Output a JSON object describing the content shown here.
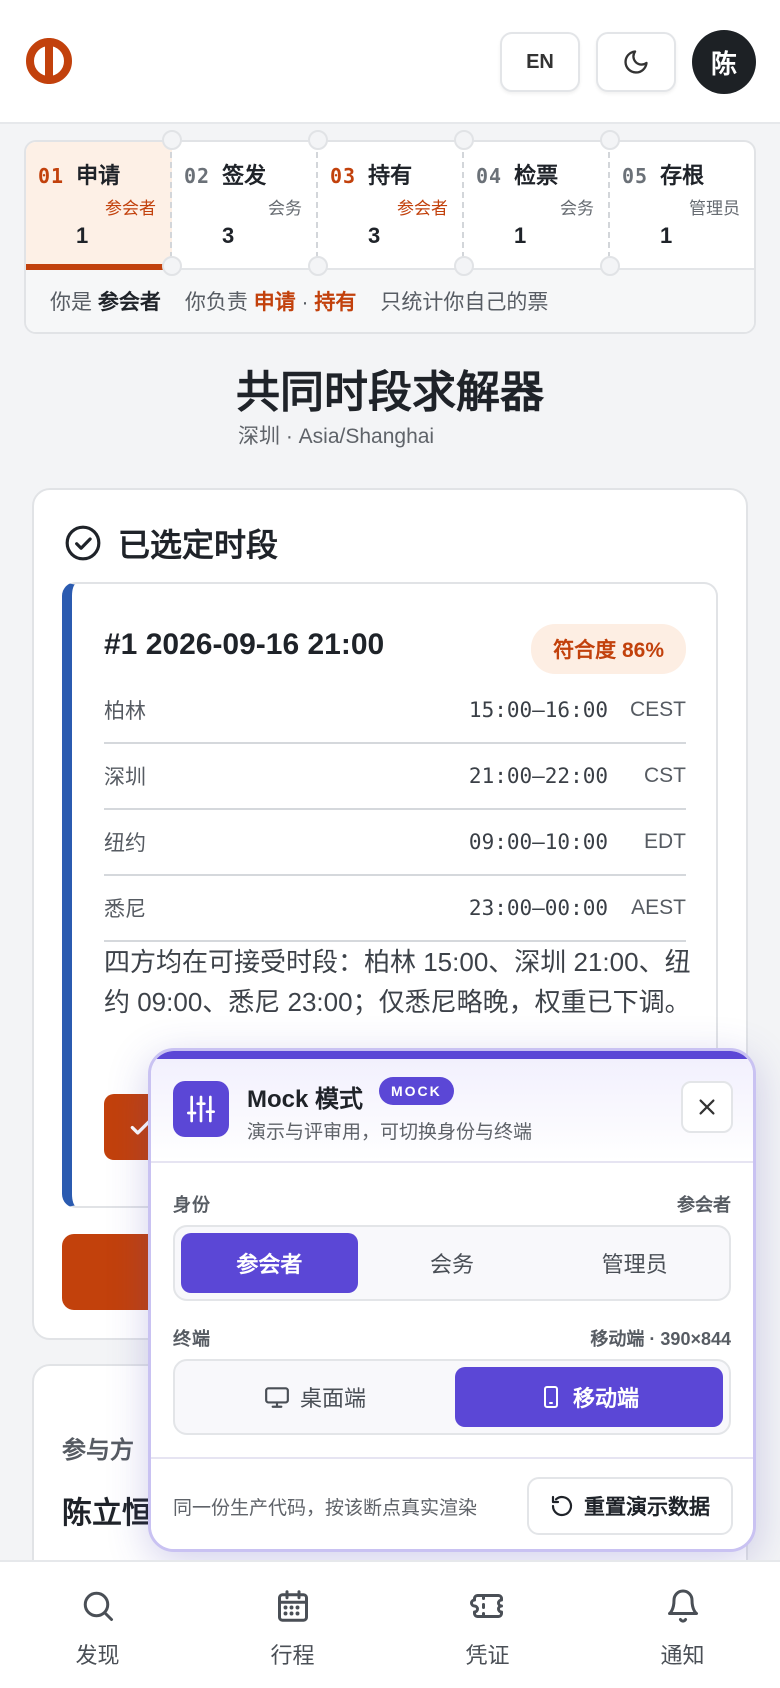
{
  "header": {
    "lang_label": "EN",
    "avatar_text": "陈",
    "brand_color": "#c2410c"
  },
  "stepper": {
    "steps": [
      {
        "num": "01",
        "name": "申请",
        "role": "参会者",
        "count": "1",
        "own": true,
        "active": true
      },
      {
        "num": "02",
        "name": "签发",
        "role": "会务",
        "count": "3",
        "own": false,
        "active": false
      },
      {
        "num": "03",
        "name": "持有",
        "role": "参会者",
        "count": "3",
        "own": true,
        "active": false
      },
      {
        "num": "04",
        "name": "检票",
        "role": "会务",
        "count": "1",
        "own": false,
        "active": false
      },
      {
        "num": "05",
        "name": "存根",
        "role": "管理员",
        "count": "1",
        "own": false,
        "active": false
      }
    ],
    "strip": {
      "you_are_prefix": "你是",
      "you_are_role": "参会者",
      "responsible_prefix": "你负责",
      "responsible_1": "申请",
      "responsible_sep": "·",
      "responsible_2": "持有",
      "note": "只统计你自己的票"
    }
  },
  "page": {
    "title": "共同时段求解器",
    "subtitle": "深圳 · Asia/Shanghai"
  },
  "selected": {
    "heading": "已选定时段",
    "slot_title": "#1 2026-09-16 21:00",
    "match_badge": "符合度 86%",
    "accent_color": "#2b5bb0",
    "rows": [
      {
        "city": "柏林",
        "time": "15:00–16:00",
        "abbr": "CEST"
      },
      {
        "city": "深圳",
        "time": "21:00–22:00",
        "abbr": "CST"
      },
      {
        "city": "纽约",
        "time": "09:00–10:00",
        "abbr": "EDT"
      },
      {
        "city": "悉尼",
        "time": "23:00–00:00",
        "abbr": "AEST"
      }
    ],
    "note": "四方均在可接受时段：柏林 15:00、深圳 21:00、纽约 09:00、悉尼 23:00；仅悉尼略晚，权重已下调。"
  },
  "participants": {
    "label": "参与方",
    "name": "陈立恒"
  },
  "mock": {
    "title": "Mock 模式",
    "tag": "MOCK",
    "desc": "演示与评审用，可切换身份与终端",
    "identity_label": "身份",
    "identity_value": "参会者",
    "identities": [
      "参会者",
      "会务",
      "管理员"
    ],
    "identity_selected": 0,
    "terminal_label": "终端",
    "terminal_value": "移动端 · 390×844",
    "terminals": [
      "桌面端",
      "移动端"
    ],
    "terminal_selected": 1,
    "footer_text": "同一份生产代码，按该断点真实渲染",
    "reset_label": "重置演示数据",
    "accent_color": "#5b47d6"
  },
  "nav": {
    "items": [
      {
        "label": "发现",
        "icon": "search-icon"
      },
      {
        "label": "行程",
        "icon": "calendar-icon"
      },
      {
        "label": "凭证",
        "icon": "ticket-icon"
      },
      {
        "label": "通知",
        "icon": "bell-icon"
      }
    ]
  }
}
